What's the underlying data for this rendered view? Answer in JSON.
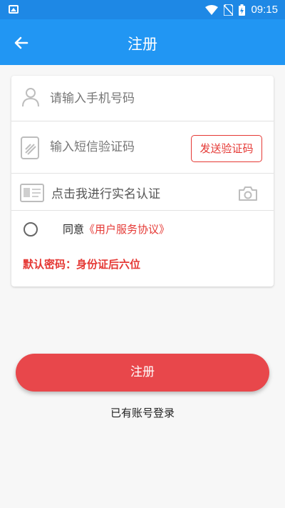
{
  "status_bar": {
    "time": "09:15"
  },
  "app_bar": {
    "title": "注册"
  },
  "form": {
    "phone_placeholder": "请输入手机号码",
    "sms_placeholder": "输入短信验证码",
    "sms_button": "发送验证码",
    "realname_label": "点击我进行实名认证",
    "agree_prefix": "同意",
    "agreement_link": "《用户服务协议》",
    "password_note": "默认密码：身份证后六位"
  },
  "actions": {
    "register_label": "注册",
    "login_label": "已有账号登录"
  },
  "colors": {
    "primary": "#2196f3",
    "status_bar": "#1e88e5",
    "accent_red": "#e53935",
    "button_red": "#e8474b"
  },
  "icons": [
    "image-icon",
    "wifi-icon",
    "no-sim-icon",
    "battery-charging-icon",
    "back-arrow-icon",
    "person-icon",
    "sms-code-icon",
    "id-card-icon",
    "camera-icon"
  ]
}
